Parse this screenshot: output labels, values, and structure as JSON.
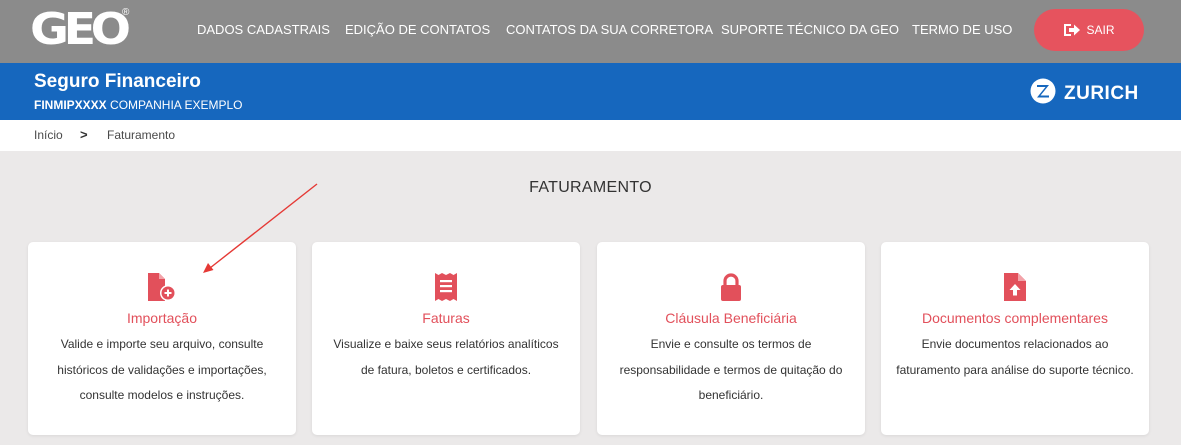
{
  "header": {
    "logo_text": "GEO",
    "logo_mark": "®",
    "nav": [
      "DADOS CADASTRAIS",
      "EDIÇÃO DE CONTATOS",
      "CONTATOS DA SUA CORRETORA",
      "SUPORTE TÉCNICO DA GEO",
      "TERMO DE USO"
    ],
    "logout_label": "SAIR",
    "logout_icon": "logout-icon"
  },
  "product": {
    "title": "Seguro Financeiro",
    "code": "FINMIPXXXX",
    "company": "COMPANHIA EXEMPLO",
    "brand": "ZURICH"
  },
  "breadcrumb": {
    "home": "Início",
    "separator": ">",
    "current": "Faturamento"
  },
  "main": {
    "title": "FATURAMENTO",
    "cards": [
      {
        "icon": "file-add-icon",
        "title": "Importação",
        "description": "Valide e importe seu arquivo, consulte históricos de validações e importações, consulte modelos e instruções."
      },
      {
        "icon": "receipt-icon",
        "title": "Faturas",
        "description": "Visualize e baixe seus relatórios analíticos de fatura, boletos e certificados."
      },
      {
        "icon": "lock-icon",
        "title": "Cláusula Beneficiária",
        "description": "Envie e consulte os termos de responsabilidade e termos de quitação do beneficiário."
      },
      {
        "icon": "file-upload-icon",
        "title": "Documentos complementares",
        "description": "Envie documentos relacionados ao faturamento para análise do suporte técnico."
      }
    ]
  },
  "colors": {
    "topbar": "#8b8b8b",
    "blue_header": "#1667be",
    "accent": "#e2505b",
    "page_bg": "#ebe9e9",
    "annotation_arrow": "#e53935"
  }
}
